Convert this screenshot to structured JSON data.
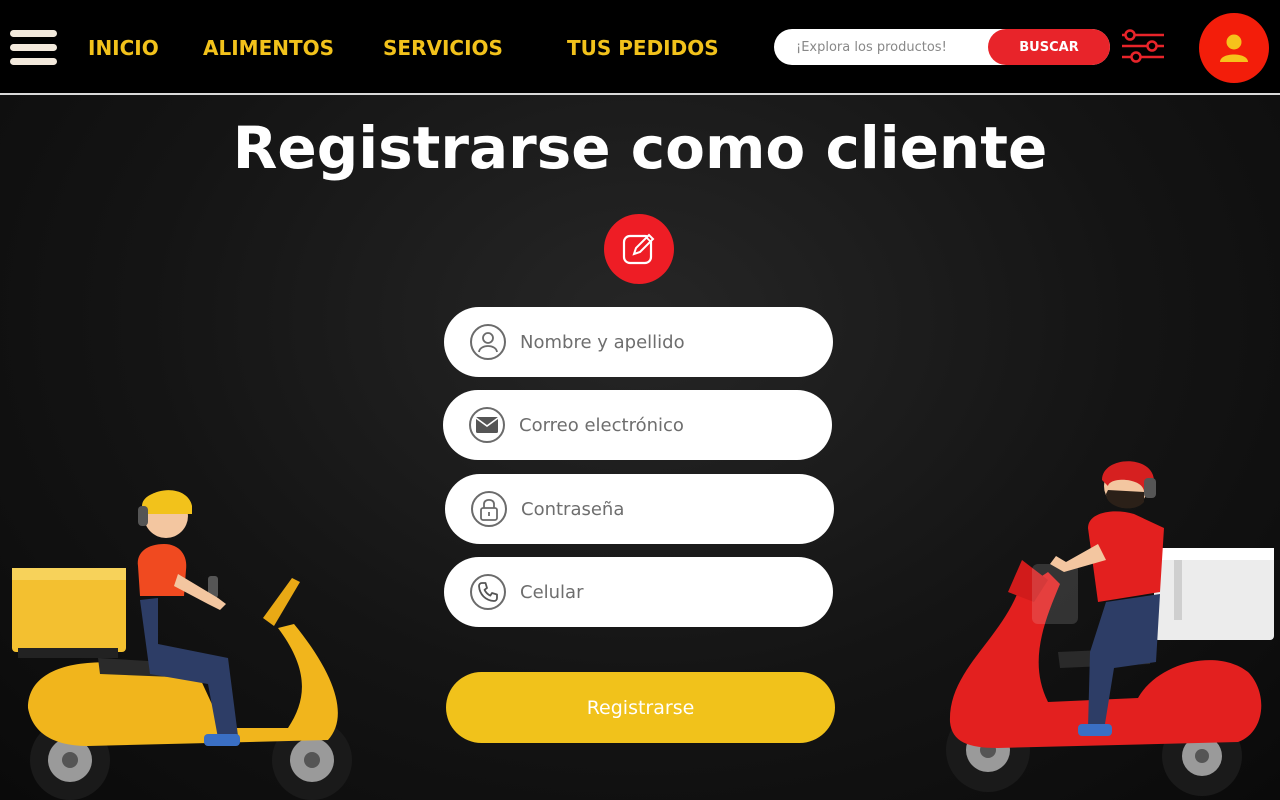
{
  "header": {
    "nav": [
      "INICIO",
      "ALIMENTOS",
      "SERVICIOS",
      "TUS PEDIDOS"
    ],
    "search": {
      "placeholder": "¡Explora los productos!",
      "button_label": "BUSCAR"
    }
  },
  "page": {
    "title": "Registrarse como cliente"
  },
  "form": {
    "fields": [
      {
        "placeholder": "Nombre y apellido",
        "icon": "user-icon"
      },
      {
        "placeholder": "Correo electrónico",
        "icon": "mail-icon"
      },
      {
        "placeholder": "Contraseña",
        "icon": "lock-icon"
      },
      {
        "placeholder": "Celular",
        "icon": "phone-icon"
      }
    ],
    "submit_label": "Registrarse"
  },
  "colors": {
    "accent_yellow": "#f1c21b",
    "accent_red": "#ee1d25",
    "header_bg": "#000000"
  }
}
